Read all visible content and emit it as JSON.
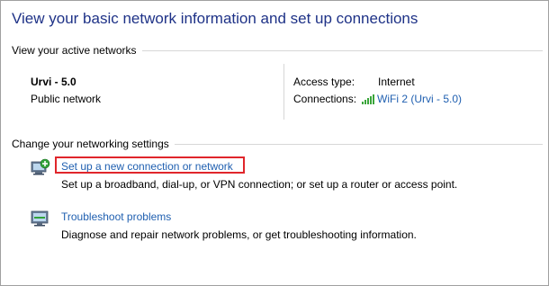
{
  "page": {
    "title": "View your basic network information and set up connections"
  },
  "active_networks": {
    "header": "View your active networks",
    "network_name": "Urvi - 5.0",
    "network_type": "Public network",
    "access_type_label": "Access type:",
    "access_type_value": "Internet",
    "connections_label": "Connections:",
    "connections_value": "WiFi 2 (Urvi - 5.0)",
    "connections_icon": "wifi-signal-icon"
  },
  "change_settings": {
    "header": "Change your networking settings",
    "tasks": [
      {
        "icon": "new-connection-icon",
        "link": "Set up a new connection or network",
        "description": "Set up a broadband, dial-up, or VPN connection; or set up a router or access point."
      },
      {
        "icon": "troubleshoot-icon",
        "link": "Troubleshoot problems",
        "description": "Diagnose and repair network problems, or get troubleshooting information."
      }
    ]
  },
  "colors": {
    "title": "#1e3287",
    "link": "#1f5fb0",
    "highlight": "#e0262b",
    "signal": "#3aa53a"
  }
}
